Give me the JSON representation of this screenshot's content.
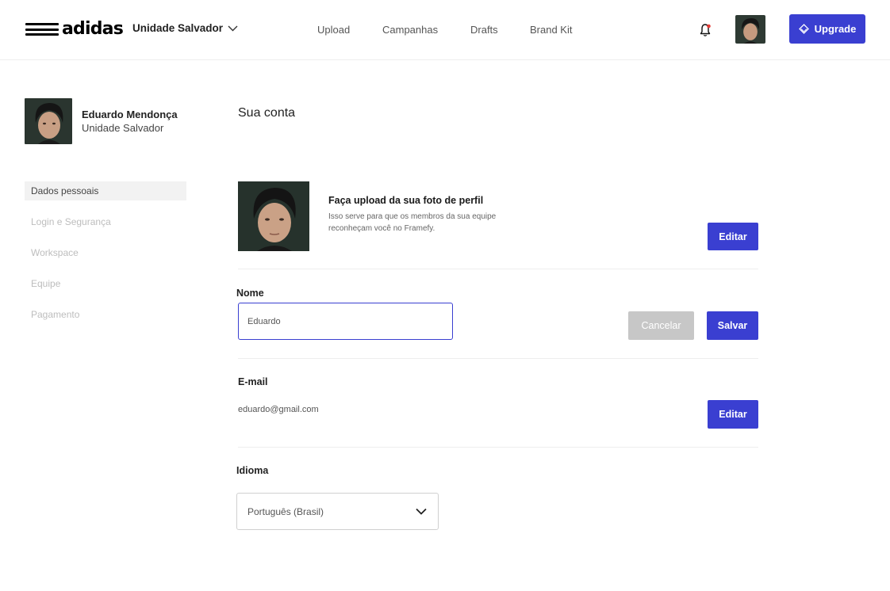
{
  "brand": {
    "logo_text": "adidas",
    "accent": "#3a3fd1"
  },
  "header": {
    "workspace": "Unidade Salvador",
    "nav": [
      "Upload",
      "Campanhas",
      "Drafts",
      "Brand Kit"
    ],
    "notification_icon": "bell-icon",
    "upgrade_label": "Upgrade",
    "upgrade_icon": "layers-icon"
  },
  "sidebar": {
    "user_name": "Eduardo Mendonça",
    "user_unit": "Unidade Salvador",
    "items": [
      {
        "label": "Dados pessoais",
        "active": true
      },
      {
        "label": "Login e Segurança",
        "active": false
      },
      {
        "label": "Workspace",
        "active": false
      },
      {
        "label": "Equipe",
        "active": false
      },
      {
        "label": "Pagamento",
        "active": false
      }
    ]
  },
  "main": {
    "title": "Sua conta",
    "photo": {
      "title": "Faça upload da sua foto de perfil",
      "description": "Isso serve para que os membros da sua equipe reconheçam você no Framefy.",
      "edit_label": "Editar"
    },
    "name": {
      "label": "Nome",
      "value": "Eduardo",
      "cancel_label": "Cancelar",
      "save_label": "Salvar"
    },
    "email": {
      "label": "E-mail",
      "value": "eduardo@gmail.com",
      "edit_label": "Editar"
    },
    "language": {
      "label": "Idioma",
      "selected": "Português (Brasil)",
      "icon": "chevron-down-icon"
    }
  }
}
